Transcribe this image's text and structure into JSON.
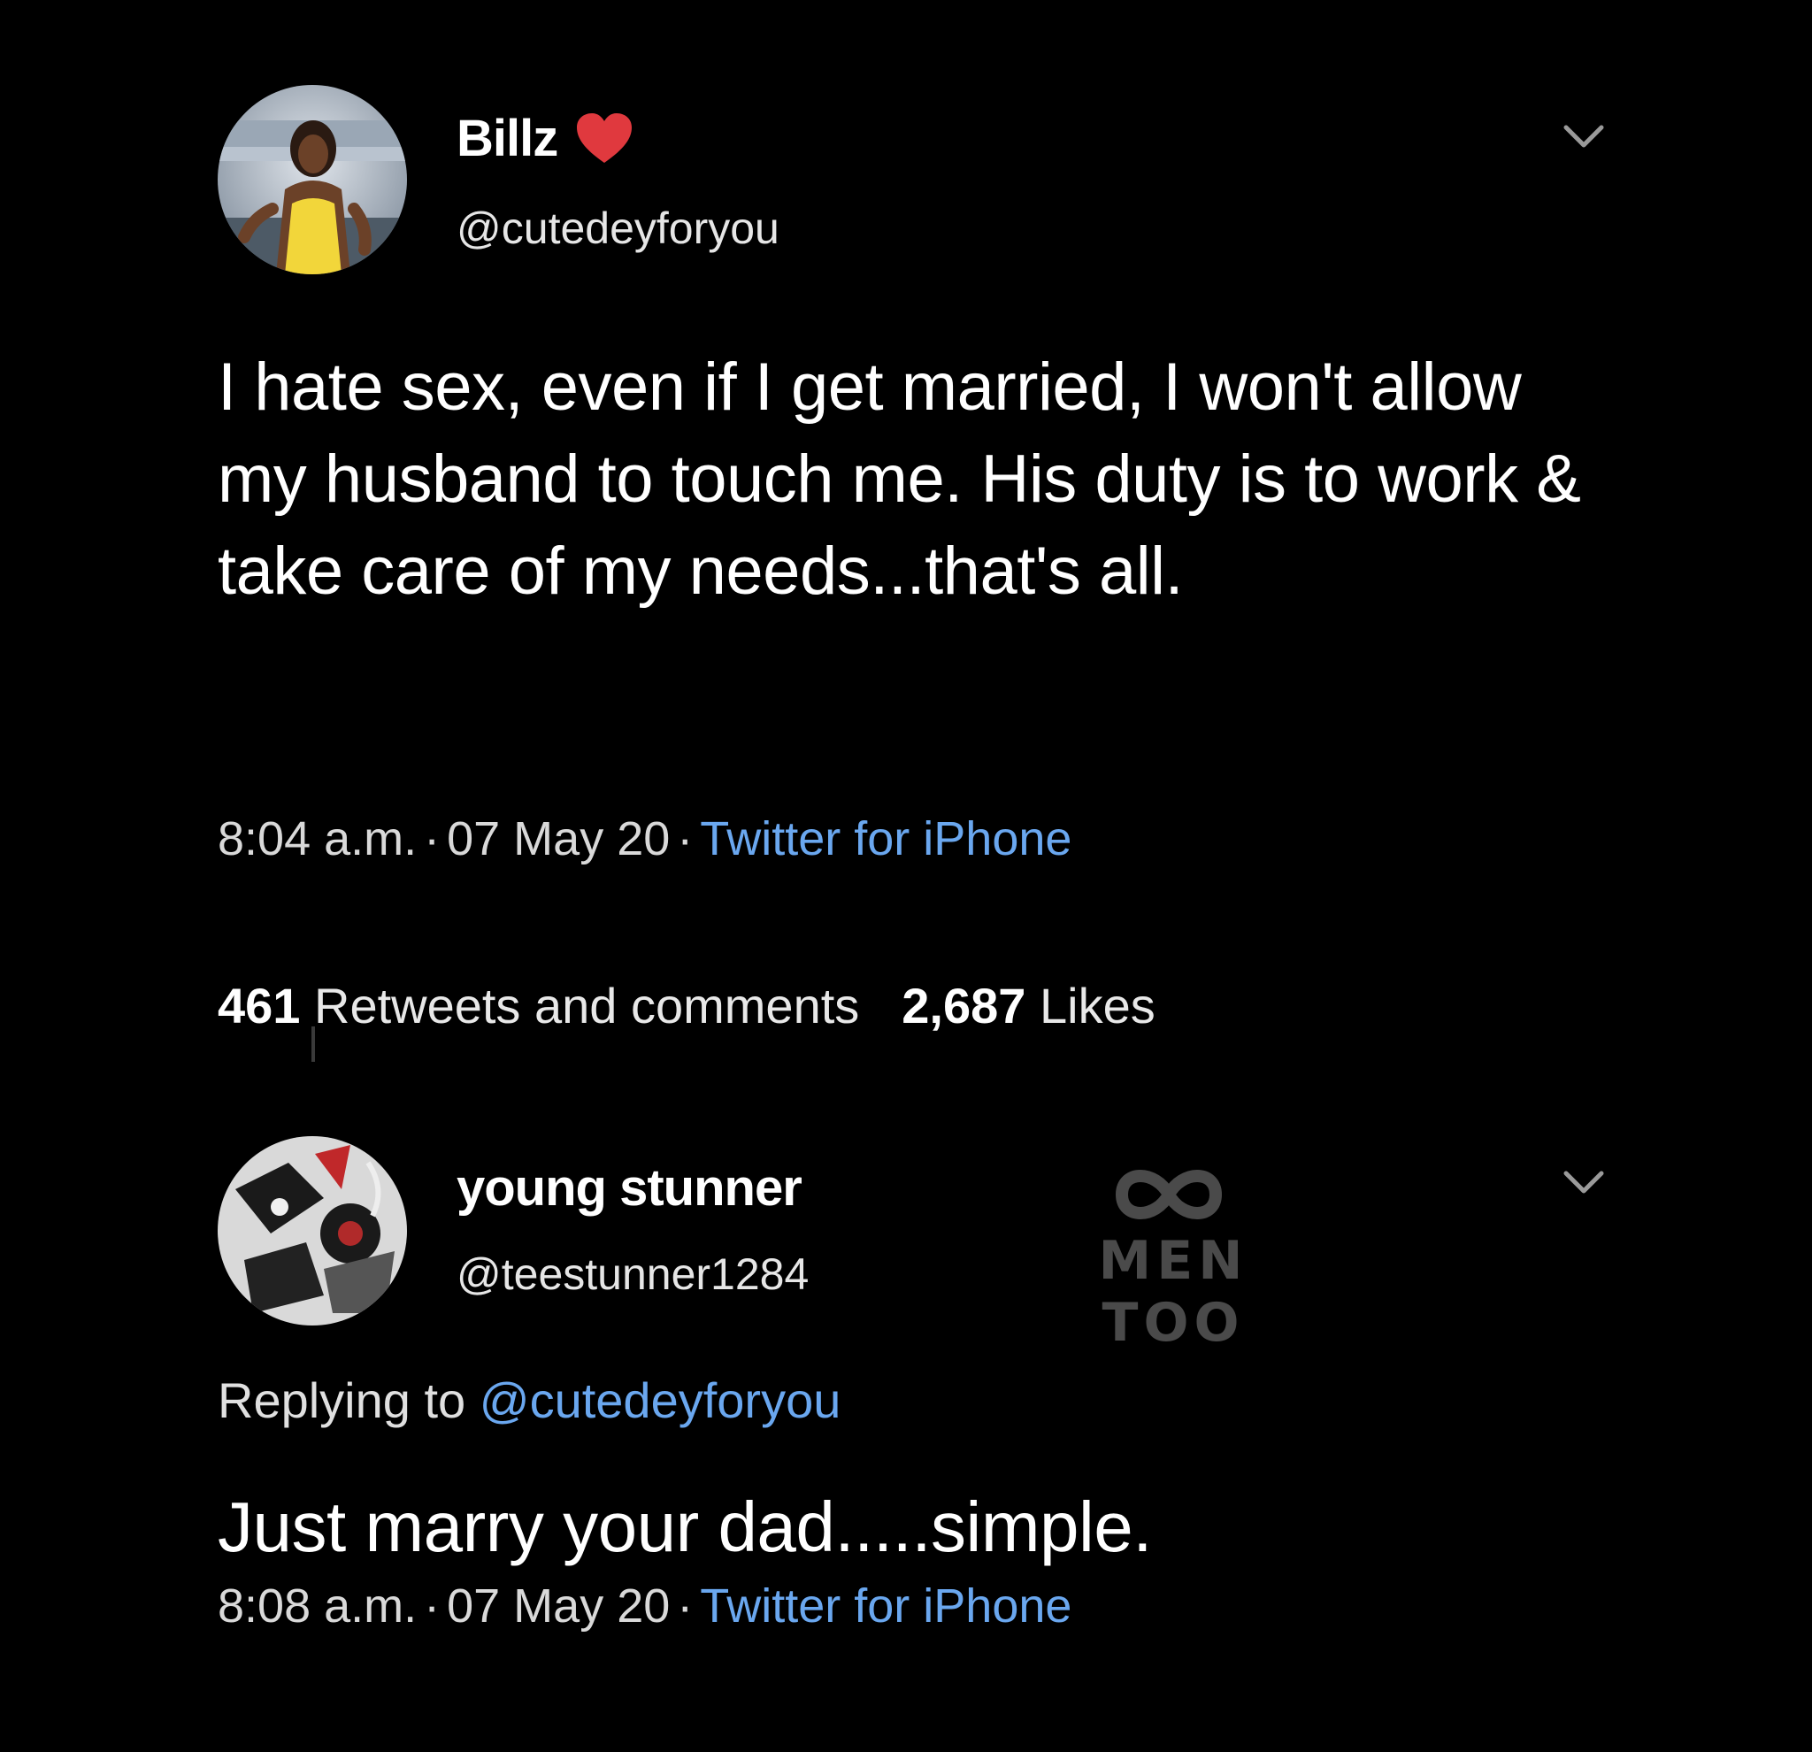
{
  "tweet1": {
    "display_name": "Billz",
    "handle": "@cutedeyforyou",
    "text": "I hate sex, even if I get married, I won't allow my husband to touch me. His duty is to work  & take care of my needs...that's all.",
    "time": "8:04 a.m.",
    "date": "07 May 20",
    "separator": "·",
    "source": "Twitter for iPhone",
    "retweets_count": "461",
    "retweets_label": "Retweets and comments",
    "likes_count": "2,687",
    "likes_label": "Likes",
    "heart_color": "#e0393e",
    "avatar_icon": "profile-photo",
    "menu_icon": "chevron-down-icon"
  },
  "tweet2": {
    "display_name": "young stunner",
    "handle": "@teestunner1284",
    "replying_label": "Replying to",
    "replying_to": "@cutedeyforyou",
    "text": "Just marry your dad.....simple.",
    "time": "8:08 a.m.",
    "date": "07 May 20",
    "separator": "·",
    "source": "Twitter for iPhone",
    "avatar_icon": "profile-photo",
    "menu_icon": "chevron-down-icon"
  },
  "watermark": {
    "text": "MEN TOO",
    "icon": "infinity-icon"
  },
  "colors": {
    "background": "#000000",
    "text": "#ffffff",
    "link": "#6aa7ef",
    "heart": "#e0393e",
    "watermark": "#4a4a4a"
  }
}
